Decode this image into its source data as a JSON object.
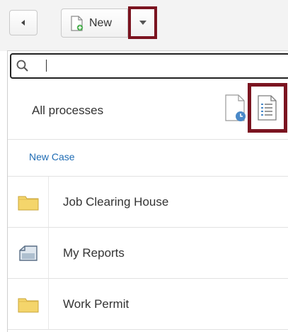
{
  "toolbar": {
    "new_label": "New"
  },
  "panel": {
    "search": {
      "value": "",
      "placeholder": ""
    },
    "section_title": "All processes",
    "new_case_label": "New Case",
    "items": [
      {
        "label": "Job Clearing House",
        "icon": "folder-icon"
      },
      {
        "label": "My Reports",
        "icon": "reports-icon"
      },
      {
        "label": "Work Permit",
        "icon": "folder-icon"
      }
    ]
  },
  "colors": {
    "highlight": "#7b1420",
    "link": "#1f6cb4",
    "folder": "#f4d56b",
    "toolbar_bg": "#f3f3f3"
  }
}
